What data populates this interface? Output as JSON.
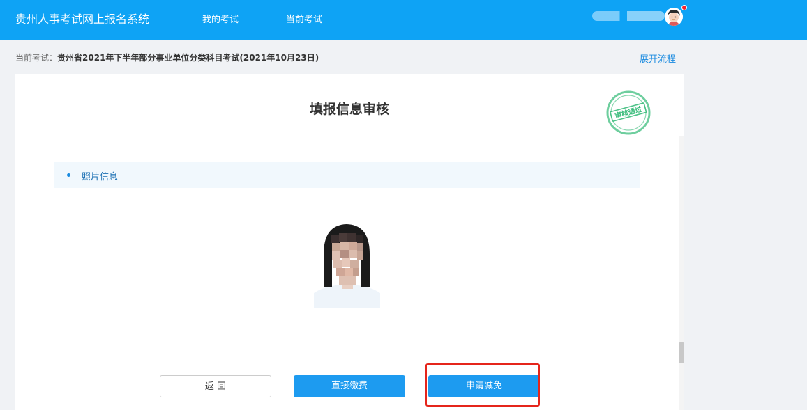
{
  "header": {
    "app_title": "贵州人事考试网上报名系统",
    "nav": [
      "我的考试",
      "当前考试"
    ]
  },
  "breadcrumb": {
    "label": "当前考试：",
    "value": "贵州省2021年下半年部分事业单位分类科目考试(2021年10月23日)",
    "expand_link": "展开流程"
  },
  "panel": {
    "title": "填报信息审核",
    "stamp_text": "审核通过",
    "section_label": "照片信息"
  },
  "actions": {
    "back": "返 回",
    "pay": "直接缴费",
    "apply_reduction": "申请减免"
  },
  "colors": {
    "header_bg": "#0ea3f5",
    "primary_button": "#1d9bf0",
    "stamp": "#3dbd7d",
    "highlight": "#e5251b"
  }
}
